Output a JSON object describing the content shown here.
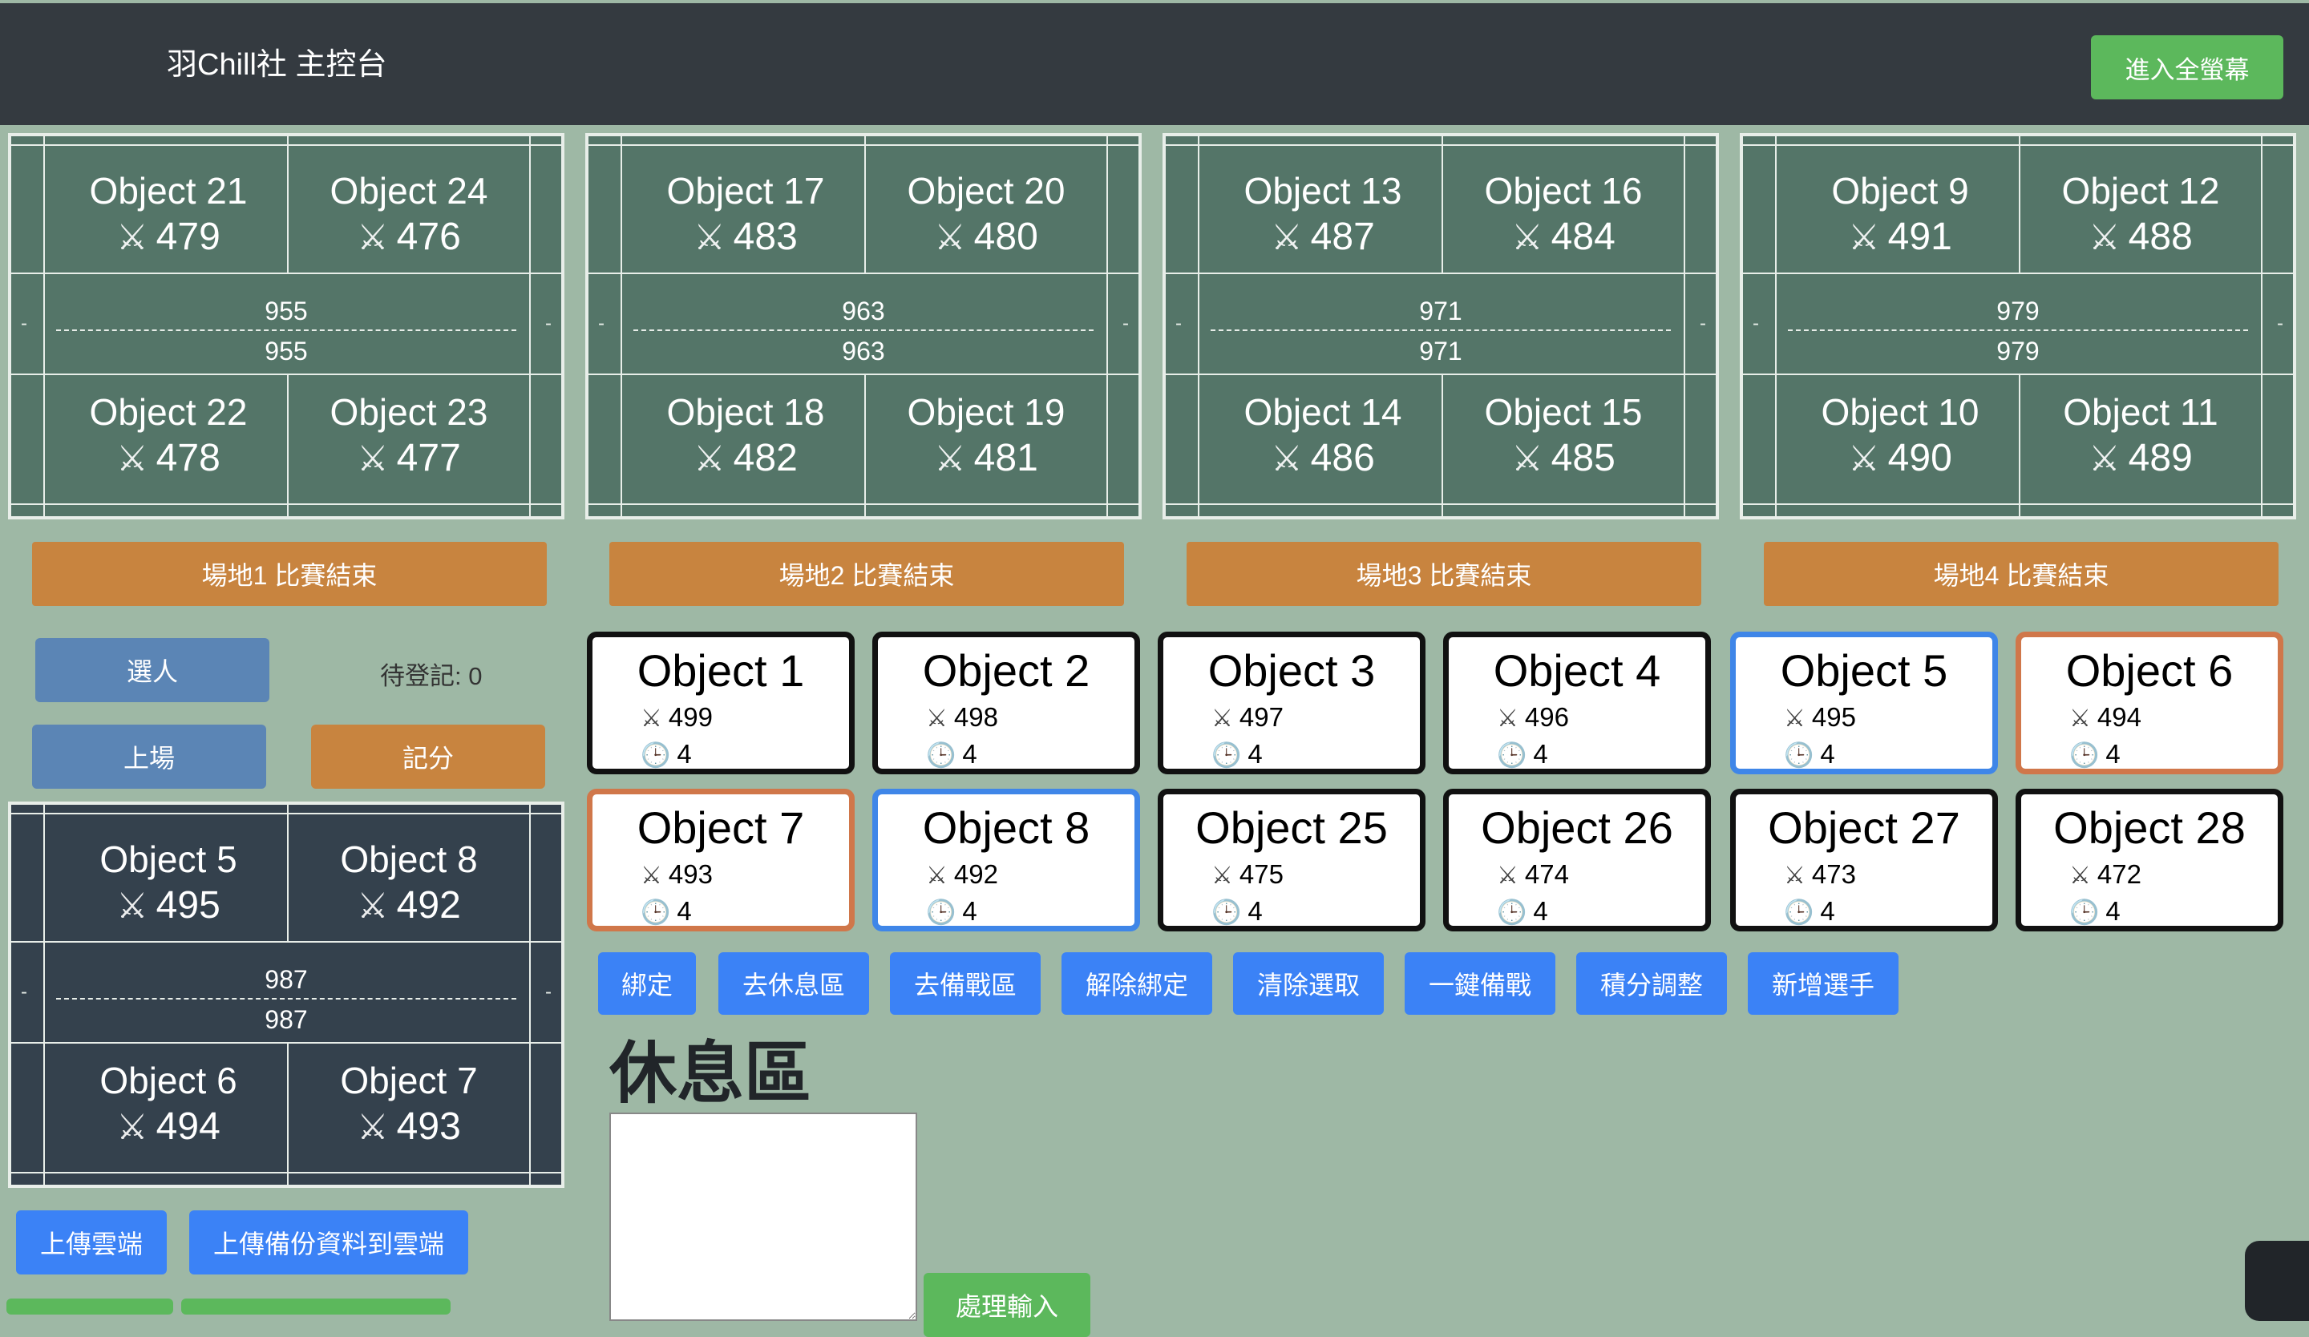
{
  "nav": {
    "title": "羽Chill社 主控台",
    "fullscreen_label": "進入全螢幕"
  },
  "courts": [
    {
      "players": [
        {
          "name": "Object 21",
          "score": "479"
        },
        {
          "name": "Object 24",
          "score": "476"
        },
        {
          "name": "Object 22",
          "score": "478"
        },
        {
          "name": "Object 23",
          "score": "477"
        }
      ],
      "score_top": "955",
      "score_bottom": "955",
      "end_label": "場地1 比賽結束"
    },
    {
      "players": [
        {
          "name": "Object 17",
          "score": "483"
        },
        {
          "name": "Object 20",
          "score": "480"
        },
        {
          "name": "Object 18",
          "score": "482"
        },
        {
          "name": "Object 19",
          "score": "481"
        }
      ],
      "score_top": "963",
      "score_bottom": "963",
      "end_label": "場地2 比賽結束"
    },
    {
      "players": [
        {
          "name": "Object 13",
          "score": "487"
        },
        {
          "name": "Object 16",
          "score": "484"
        },
        {
          "name": "Object 14",
          "score": "486"
        },
        {
          "name": "Object 15",
          "score": "485"
        }
      ],
      "score_top": "971",
      "score_bottom": "971",
      "end_label": "場地3 比賽結束"
    },
    {
      "players": [
        {
          "name": "Object 9",
          "score": "491"
        },
        {
          "name": "Object 12",
          "score": "488"
        },
        {
          "name": "Object 10",
          "score": "490"
        },
        {
          "name": "Object 11",
          "score": "489"
        }
      ],
      "score_top": "979",
      "score_bottom": "979",
      "end_label": "場地4 比賽結束"
    }
  ],
  "side_mark": "-",
  "controls": {
    "select_label": "選人",
    "pending_label": "待登記: 0",
    "onfield_label": "上場",
    "score_label": "記分"
  },
  "preview": {
    "players": [
      {
        "name": "Object 5",
        "score": "495"
      },
      {
        "name": "Object 8",
        "score": "492"
      },
      {
        "name": "Object 6",
        "score": "494"
      },
      {
        "name": "Object 7",
        "score": "493"
      }
    ],
    "score_top": "987",
    "score_bottom": "987"
  },
  "cloud": {
    "upload_label": "上傳雲端",
    "backup_label": "上傳備份資料到雲端"
  },
  "cards": [
    {
      "name": "Object 1",
      "score": "499",
      "games": "4"
    },
    {
      "name": "Object 2",
      "score": "498",
      "games": "4"
    },
    {
      "name": "Object 3",
      "score": "497",
      "games": "4"
    },
    {
      "name": "Object 4",
      "score": "496",
      "games": "4"
    },
    {
      "name": "Object 5",
      "score": "495",
      "games": "4"
    },
    {
      "name": "Object 6",
      "score": "494",
      "games": "4"
    },
    {
      "name": "Object 7",
      "score": "493",
      "games": "4"
    },
    {
      "name": "Object 8",
      "score": "492",
      "games": "4"
    },
    {
      "name": "Object 25",
      "score": "475",
      "games": "4"
    },
    {
      "name": "Object 26",
      "score": "474",
      "games": "4"
    },
    {
      "name": "Object 27",
      "score": "473",
      "games": "4"
    },
    {
      "name": "Object 28",
      "score": "472",
      "games": "4"
    }
  ],
  "actions": [
    "綁定",
    "去休息區",
    "去備戰區",
    "解除綁定",
    "清除選取",
    "一鍵備戰",
    "積分調整",
    "新增選手"
  ],
  "rest": {
    "title": "休息區",
    "input_value": "",
    "process_label": "處理輸入"
  },
  "colors": {
    "court_green": "#547568",
    "court_dark": "#34414d",
    "accent_orange": "#c8843f",
    "accent_blue": "#3b82f6",
    "select_blue": "#3f86e8",
    "select_orange": "#d0774a"
  },
  "icons": {
    "score": "swords-icon",
    "games": "clock-icon"
  }
}
